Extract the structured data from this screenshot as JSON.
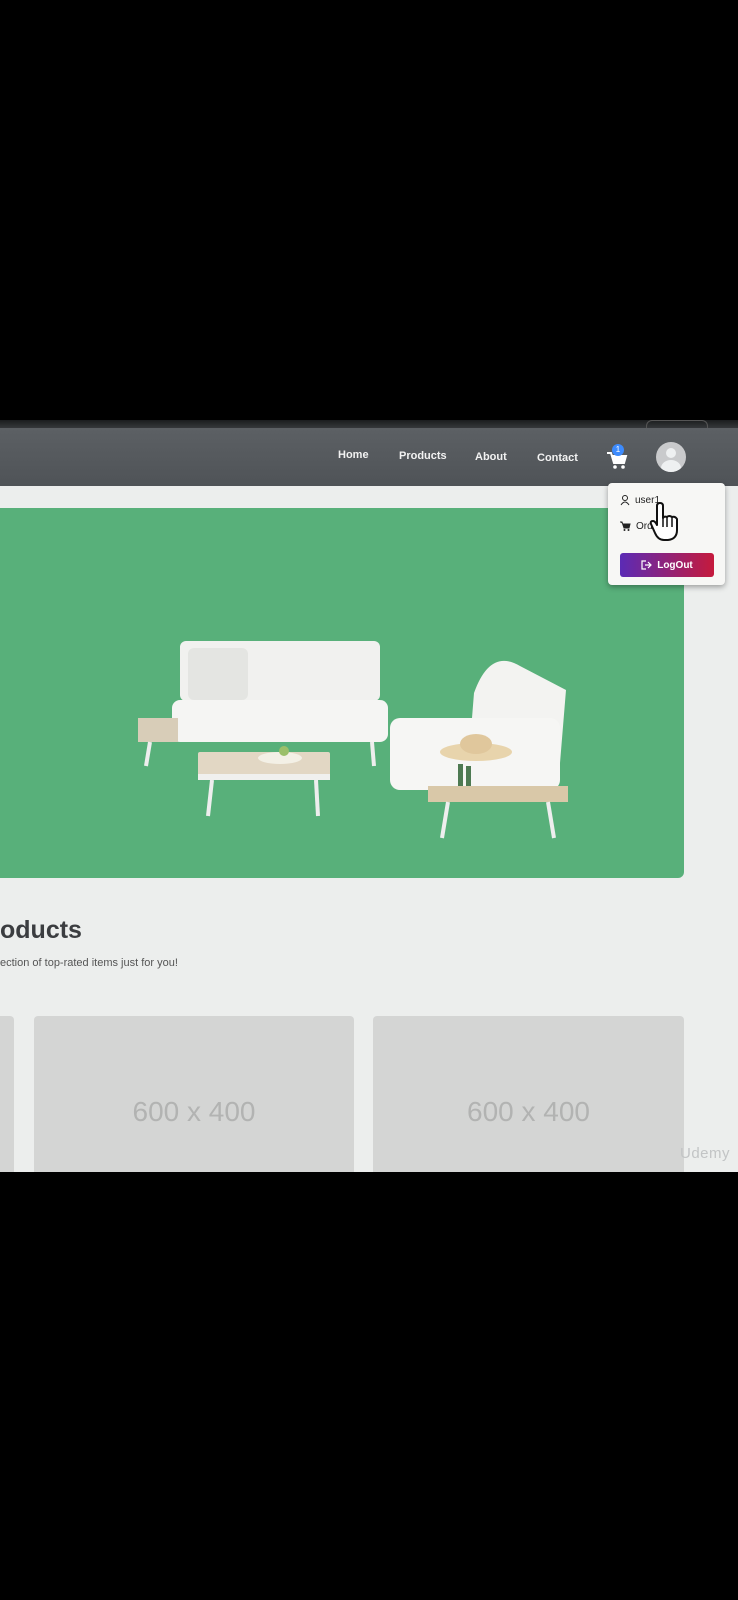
{
  "nav": {
    "links": [
      "Home",
      "Products",
      "About",
      "Contact"
    ],
    "cart_count": "1"
  },
  "user_menu": {
    "username": "user1",
    "orders_label": "Ord",
    "logout_label": "LogOut"
  },
  "products_section": {
    "title": "oducts",
    "subtitle": "ection of top-rated items just for you!"
  },
  "cards": [
    {
      "placeholder": "600 x 400"
    },
    {
      "placeholder": "600 x 400"
    }
  ],
  "watermark": "Udemy",
  "colors": {
    "navbar": "#52565a",
    "hero_green": "#58b07a",
    "cart_badge": "#3d8bfd",
    "logout_gradient_start": "#5b2bb5",
    "logout_gradient_end": "#c51a3c"
  },
  "icons": [
    "cart-icon",
    "user-icon",
    "avatar-icon",
    "logout-icon",
    "hand-pointer-icon"
  ]
}
